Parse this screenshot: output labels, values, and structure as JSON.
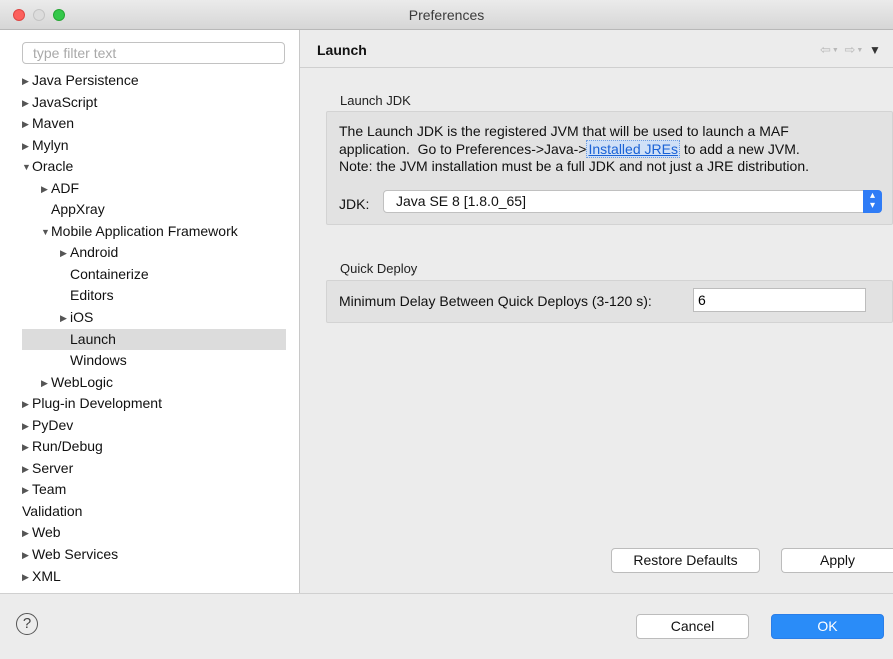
{
  "window": {
    "title": "Preferences"
  },
  "filter": {
    "placeholder": "type filter text",
    "value": ""
  },
  "tree": [
    {
      "label": "Java Persistence",
      "level": 0,
      "expander": "collapsed"
    },
    {
      "label": "JavaScript",
      "level": 0,
      "expander": "collapsed"
    },
    {
      "label": "Maven",
      "level": 0,
      "expander": "collapsed"
    },
    {
      "label": "Mylyn",
      "level": 0,
      "expander": "collapsed"
    },
    {
      "label": "Oracle",
      "level": 0,
      "expander": "expanded"
    },
    {
      "label": "ADF",
      "level": 1,
      "expander": "collapsed"
    },
    {
      "label": "AppXray",
      "level": 1,
      "expander": "none"
    },
    {
      "label": "Mobile Application Framework",
      "level": 1,
      "expander": "expanded"
    },
    {
      "label": "Android",
      "level": 2,
      "expander": "collapsed"
    },
    {
      "label": "Containerize",
      "level": 2,
      "expander": "none"
    },
    {
      "label": "Editors",
      "level": 2,
      "expander": "none"
    },
    {
      "label": "iOS",
      "level": 2,
      "expander": "collapsed"
    },
    {
      "label": "Launch",
      "level": 2,
      "expander": "none",
      "selected": true
    },
    {
      "label": "Windows",
      "level": 2,
      "expander": "none"
    },
    {
      "label": "WebLogic",
      "level": 1,
      "expander": "collapsed"
    },
    {
      "label": "Plug-in Development",
      "level": 0,
      "expander": "collapsed"
    },
    {
      "label": "PyDev",
      "level": 0,
      "expander": "collapsed"
    },
    {
      "label": "Run/Debug",
      "level": 0,
      "expander": "collapsed"
    },
    {
      "label": "Server",
      "level": 0,
      "expander": "collapsed"
    },
    {
      "label": "Team",
      "level": 0,
      "expander": "collapsed"
    },
    {
      "label": "Validation",
      "level": 0,
      "expander": "none"
    },
    {
      "label": "Web",
      "level": 0,
      "expander": "collapsed"
    },
    {
      "label": "Web Services",
      "level": 0,
      "expander": "collapsed"
    },
    {
      "label": "XML",
      "level": 0,
      "expander": "collapsed"
    }
  ],
  "page": {
    "title": "Launch",
    "nav_icons": [
      "back-arrow-icon",
      "forward-arrow-icon",
      "view-menu-icon"
    ]
  },
  "launch_jdk": {
    "group_label": "Launch JDK",
    "line1": "The Launch JDK is the registered JVM that will be used to launch a MAF",
    "line2_before": "application.  Go to Preferences->Java->",
    "link": "Installed JREs",
    "line2_after": " to add a new JVM.",
    "line3": "Note: the JVM installation must be a full JDK and not just a JRE distribution.",
    "jdk_label": "JDK:",
    "jdk_selected": "Java SE 8 [1.8.0_65]"
  },
  "quick_deploy": {
    "group_label": "Quick Deploy",
    "label": "Minimum Delay Between Quick Deploys (3-120 s):",
    "value": "6"
  },
  "buttons": {
    "restore_defaults": "Restore Defaults",
    "apply": "Apply",
    "cancel": "Cancel",
    "ok": "OK"
  },
  "colors": {
    "accent": "#2a8cf8",
    "selection": "#dcdcdc",
    "link": "#1a62d6"
  }
}
